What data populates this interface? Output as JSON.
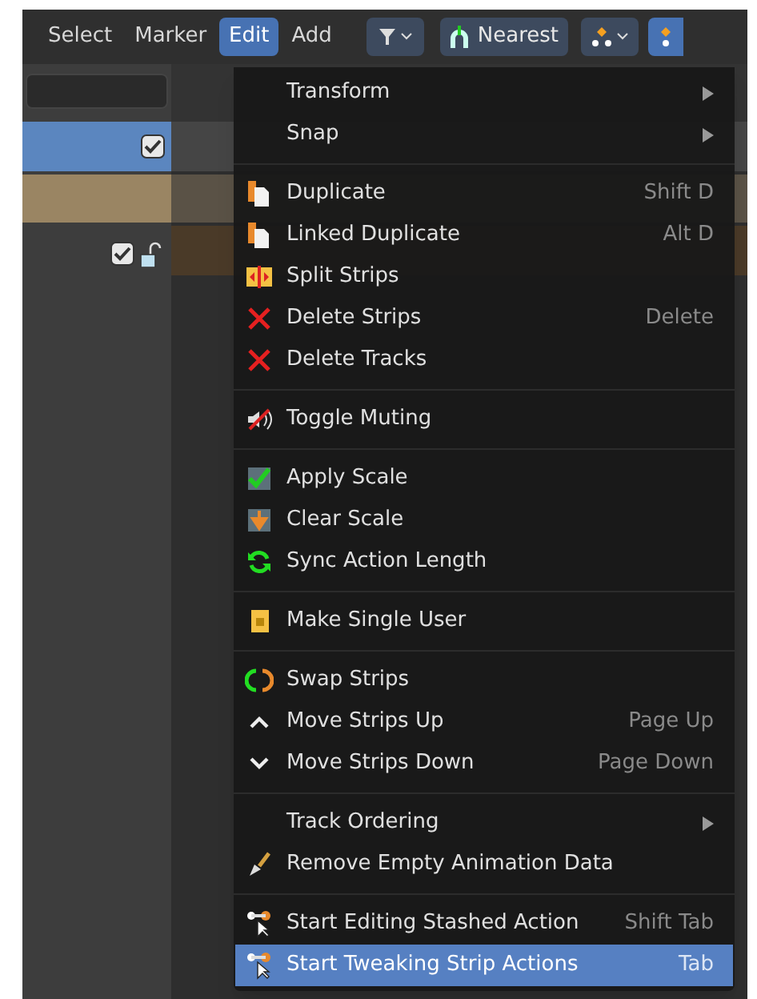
{
  "header": {
    "menus": [
      {
        "label": "Select",
        "selected": false
      },
      {
        "label": "Marker",
        "selected": false
      },
      {
        "label": "Edit",
        "selected": true
      },
      {
        "label": "Add",
        "selected": false
      }
    ],
    "snap": {
      "label": "Nearest"
    }
  },
  "channels": [
    {
      "kind": "track",
      "selected": true,
      "checked": true
    },
    {
      "kind": "action",
      "selected": false
    },
    {
      "kind": "object",
      "selected": false,
      "checked": true,
      "locked": false
    }
  ],
  "edit_menu": {
    "sections": [
      {
        "items": [
          {
            "label": "Transform",
            "submenu": true,
            "selected": false
          },
          {
            "label": "Snap",
            "submenu": true,
            "selected": false
          }
        ]
      },
      {
        "items": [
          {
            "label": "Duplicate",
            "shortcut": "Shift D",
            "selected": false
          },
          {
            "label": "Linked Duplicate",
            "shortcut": "Alt D",
            "selected": false
          },
          {
            "label": "Split Strips",
            "selected": false
          },
          {
            "label": "Delete Strips",
            "shortcut": "Delete",
            "selected": false
          },
          {
            "label": "Delete Tracks",
            "selected": false
          }
        ]
      },
      {
        "items": [
          {
            "label": "Toggle Muting",
            "selected": false
          }
        ]
      },
      {
        "items": [
          {
            "label": "Apply Scale",
            "selected": false
          },
          {
            "label": "Clear Scale",
            "selected": false
          },
          {
            "label": "Sync Action Length",
            "selected": false
          }
        ]
      },
      {
        "items": [
          {
            "label": "Make Single User",
            "selected": false
          }
        ]
      },
      {
        "items": [
          {
            "label": "Swap Strips",
            "selected": false
          },
          {
            "label": "Move Strips Up",
            "shortcut": "Page Up",
            "selected": false
          },
          {
            "label": "Move Strips Down",
            "shortcut": "Page Down",
            "selected": false
          }
        ]
      },
      {
        "items": [
          {
            "label": "Track Ordering",
            "submenu": true,
            "selected": false
          },
          {
            "label": "Remove Empty Animation Data",
            "selected": false
          }
        ]
      },
      {
        "items": [
          {
            "label": "Start Editing Stashed Action",
            "shortcut": "Shift Tab",
            "selected": false
          },
          {
            "label": "Start Tweaking Strip Actions",
            "shortcut": "Tab",
            "selected": true
          }
        ]
      }
    ]
  }
}
